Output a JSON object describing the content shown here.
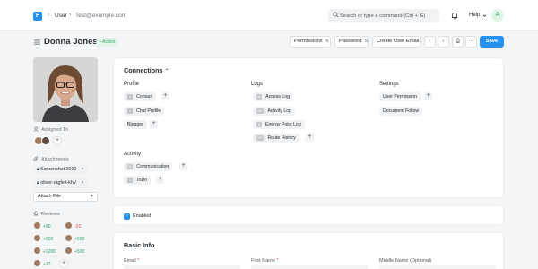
{
  "navbar": {
    "logo_letter": "F",
    "breadcrumb": [
      "User",
      "Test@example.com"
    ],
    "search_placeholder": "Search or type a command (Ctrl + G)",
    "help_label": "Help",
    "avatar_initial": "A"
  },
  "header": {
    "title": "Donna Jones",
    "status": "• Active",
    "buttons": {
      "permissions": "Permissions",
      "password": "Password",
      "create_user_email": "Create User Email",
      "prev": "‹",
      "next": "›",
      "print": "⎙",
      "more": "···",
      "save": "Save"
    }
  },
  "sidebar": {
    "assigned_to_label": "Assigned To",
    "attachments_label": "Attachments",
    "attachments": [
      "Screenshot 2020",
      "oliver-ragfelt-khV"
    ],
    "attach_file_label": "Attach File",
    "reviews_label": "Reviews",
    "reviews": [
      {
        "a": "+50",
        "b": "-20"
      },
      {
        "a": "+500",
        "b": "+500"
      },
      {
        "a": "+1200",
        "b": "+500"
      },
      {
        "a": "+12"
      }
    ]
  },
  "connections": {
    "title": "Connections",
    "profile": {
      "title": "Profile",
      "items": [
        {
          "count": "2",
          "label": "Contact"
        },
        {
          "count": "1",
          "label": "Chat Profile"
        },
        {
          "count": "",
          "label": "Blogger"
        }
      ]
    },
    "logs": {
      "title": "Logs",
      "items": [
        {
          "count": "20",
          "label": "Access Log"
        },
        {
          "count": "20+",
          "label": "Activity Log"
        },
        {
          "count": "3",
          "label": "Energy Point Log"
        },
        {
          "count": "20+",
          "label": "Route History"
        }
      ]
    },
    "settings": {
      "title": "Settings",
      "items": [
        {
          "label": "User Permission"
        },
        {
          "label": "Document Follow"
        }
      ]
    },
    "activity": {
      "title": "Activity",
      "items": [
        {
          "count": "20",
          "label": "Communication"
        },
        {
          "count": "1",
          "label": "ToDo"
        }
      ]
    }
  },
  "enabled": {
    "label": "Enabled",
    "checked": true
  },
  "basic_info": {
    "title": "Basic Info",
    "fields": [
      {
        "label": "Email",
        "required": "*"
      },
      {
        "label": "First Name",
        "required": "*"
      },
      {
        "label": "Middle Name (Optional)",
        "required": ""
      }
    ]
  },
  "colors": {
    "accent": "#2490ef",
    "success": "#30a66d",
    "danger": "#e24c4c"
  }
}
